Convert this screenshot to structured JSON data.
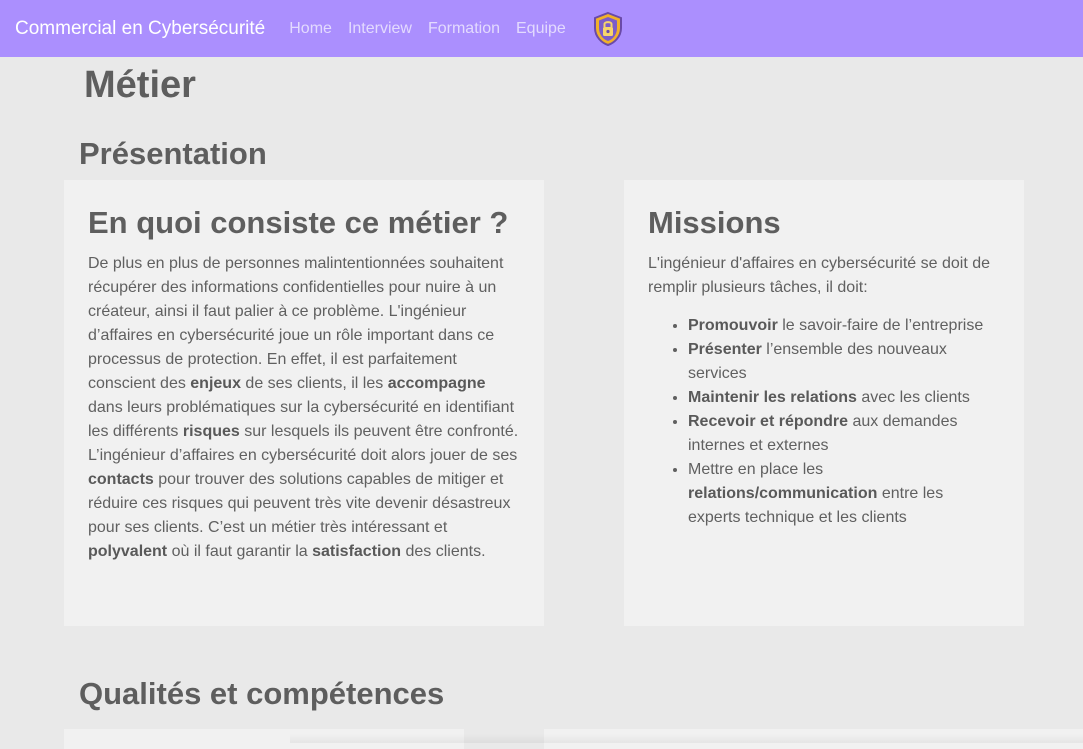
{
  "navbar": {
    "brand": "Commercial en Cybersécurité",
    "links": [
      "Home",
      "Interview",
      "Formation",
      "Equipe"
    ],
    "logo_icon": "shield-lock-icon",
    "background": "#ab8ffe"
  },
  "page": {
    "title": "Métier"
  },
  "presentation": {
    "heading": "Présentation",
    "card1": {
      "title": "En quoi consiste ce métier ?",
      "p_1": "De plus en plus de personnes malintentionnées souhaitent récupérer des informations confidentielles pour nuire à un créateur, ainsi il faut palier à ce problème. L'ingénieur d’affaires en cybersécurité joue un rôle important dans ce processus de protection. En effet, il est parfaitement conscient des ",
      "b_1": "enjeux",
      "p_2": " de ses clients, il les ",
      "b_2": "accompagne",
      "p_3": " dans leurs problématiques sur la cybersécurité en identifiant les différents ",
      "b_3": "risques",
      "p_4": " sur lesquels ils peuvent être confronté. L’ingénieur d’affaires en cybersécurité doit alors jouer de ses ",
      "b_4": "contacts",
      "p_5": " pour trouver des solutions capables de mitiger et réduire ces risques qui peuvent très vite devenir désastreux pour ses clients. C’est un métier très intéressant et ",
      "b_5": "polyvalent",
      "p_6": " où il faut garantir la ",
      "b_6": "satisfaction",
      "p_7": " des clients."
    },
    "card2": {
      "title": "Missions",
      "intro": "L'ingénieur d'affaires en cybersécurité se doit de remplir plusieurs tâches, il doit:",
      "items": [
        {
          "bold": "Promouvoir",
          "text": " le savoir-faire de l’entreprise"
        },
        {
          "bold": "Présenter",
          "text": " l’ensemble des nouveaux services"
        },
        {
          "bold": "Maintenir les relations",
          "text": " avec les clients"
        },
        {
          "bold": "Recevoir et répondre",
          "text": " aux demandes internes et externes"
        },
        {
          "pre": "Mettre en place les ",
          "bold": "relations/communication",
          "text": " entre les experts technique et les clients"
        }
      ]
    }
  },
  "qualities": {
    "heading": "Qualités et compétences"
  }
}
